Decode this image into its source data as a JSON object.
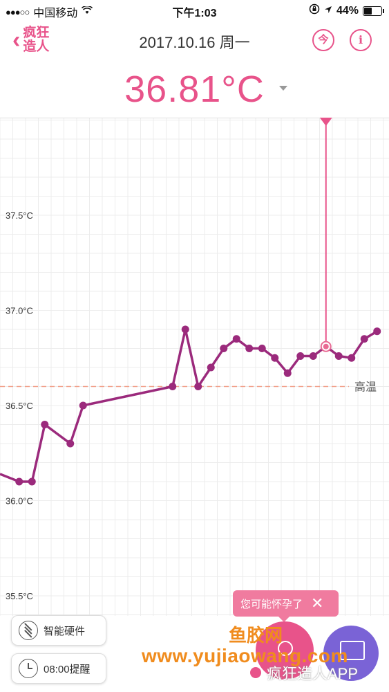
{
  "status_bar": {
    "carrier": "中国移动",
    "signal_dots": "●●●○○",
    "time": "下午1:03",
    "battery_percent": "44%",
    "battery_level": 0.44
  },
  "header": {
    "back_logo": "疯狂\n造人",
    "date_title": "2017.10.16 周一",
    "today_icon_label": "今",
    "info_icon_label": "i"
  },
  "temperature": {
    "value": "36.81°C"
  },
  "chart_data": {
    "type": "line",
    "ylabels": [
      "37.5°C",
      "37.0°C",
      "36.5°C",
      "36.0°C",
      "35.5°C"
    ],
    "ylim": [
      35.5,
      37.5
    ],
    "threshold": 36.6,
    "threshold_label": "高温",
    "grid": true,
    "series": [
      {
        "values": [
          {
            "x": 0,
            "y": 36.14
          },
          {
            "x": 1.5,
            "y": 36.1
          },
          {
            "x": 2.5,
            "y": 36.1
          },
          {
            "x": 3.5,
            "y": 36.4
          },
          {
            "x": 5.5,
            "y": 36.3
          },
          {
            "x": 6.5,
            "y": 36.5
          },
          {
            "x": 13.5,
            "y": 36.6
          },
          {
            "x": 14.5,
            "y": 36.9
          },
          {
            "x": 15.5,
            "y": 36.6
          },
          {
            "x": 16.5,
            "y": 36.7
          },
          {
            "x": 17.5,
            "y": 36.8
          },
          {
            "x": 18.5,
            "y": 36.85
          },
          {
            "x": 19.5,
            "y": 36.8
          },
          {
            "x": 20.5,
            "y": 36.8
          },
          {
            "x": 21.5,
            "y": 36.75
          },
          {
            "x": 22.5,
            "y": 36.67
          },
          {
            "x": 23.5,
            "y": 36.76
          },
          {
            "x": 24.5,
            "y": 36.76
          },
          {
            "x": 25.5,
            "y": 36.81
          },
          {
            "x": 26.5,
            "y": 36.76
          },
          {
            "x": 27.5,
            "y": 36.75
          },
          {
            "x": 28.5,
            "y": 36.85
          },
          {
            "x": 29.5,
            "y": 36.89
          }
        ]
      }
    ],
    "selected_index": 18
  },
  "colors": {
    "accent": "#e8538a",
    "line": "#9b2a7c",
    "threshold": "#f2a08a",
    "device_button": "#7a63d6",
    "tooltip": "#f07b9f"
  },
  "bottom": {
    "hardware_button": "智能硬件",
    "alarm_button": "08:00提醒",
    "tooltip_text": "您可能怀孕了",
    "watermark_top": "鱼胶网",
    "watermark_url": "www.yujiaowang.com",
    "watermark_app": "疯狂造人APP"
  }
}
